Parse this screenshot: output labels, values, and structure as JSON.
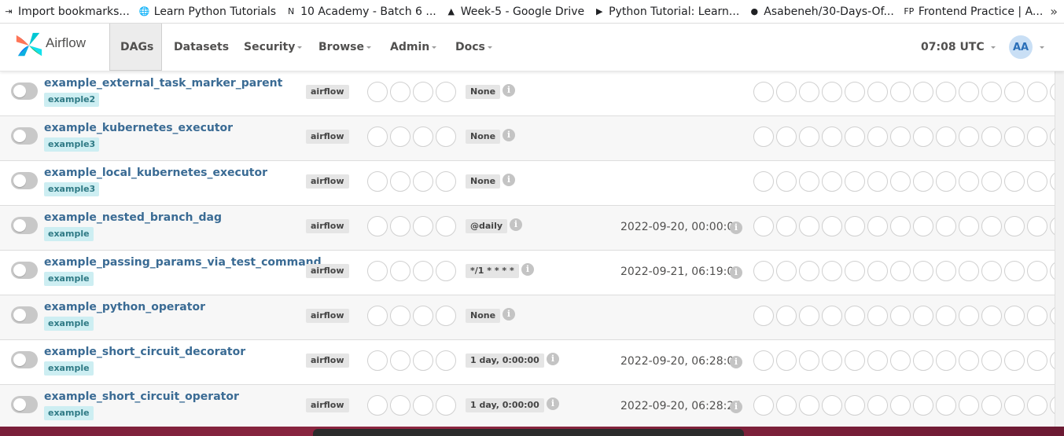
{
  "bookmarks": {
    "items": [
      {
        "label": "Import bookmarks...",
        "icon": "import-icon",
        "icon_glyph": "⇥"
      },
      {
        "label": "Learn Python Tutorials",
        "icon": "globe-icon",
        "icon_glyph": "🌐"
      },
      {
        "label": "10 Academy - Batch 6 ...",
        "icon": "notion-icon",
        "icon_glyph": "N"
      },
      {
        "label": "Week-5 - Google Drive",
        "icon": "google-drive-icon",
        "icon_glyph": "▲"
      },
      {
        "label": "Python Tutorial: Learn...",
        "icon": "youtube-icon",
        "icon_glyph": "▶"
      },
      {
        "label": "Asabeneh/30-Days-Of...",
        "icon": "github-icon",
        "icon_glyph": "●"
      },
      {
        "label": "Frontend Practice | A...",
        "icon": "fp-icon",
        "icon_glyph": "FP"
      }
    ],
    "more_glyph": "»"
  },
  "navbar": {
    "brand": "Airflow",
    "items": [
      {
        "label": "DAGs",
        "dropdown": false,
        "active": true
      },
      {
        "label": "Datasets",
        "dropdown": false,
        "active": false
      },
      {
        "label": "Security",
        "dropdown": true,
        "active": false
      },
      {
        "label": "Browse",
        "dropdown": true,
        "active": false
      },
      {
        "label": "Admin",
        "dropdown": true,
        "active": false
      },
      {
        "label": "Docs",
        "dropdown": true,
        "active": false
      }
    ],
    "clock": "07:08 UTC",
    "avatar": "AA"
  },
  "dags": [
    {
      "dag_id": "example_external_task_marker_parent",
      "tag": "example2",
      "owner": "airflow",
      "schedule": "None",
      "next_run": ""
    },
    {
      "dag_id": "example_kubernetes_executor",
      "tag": "example3",
      "owner": "airflow",
      "schedule": "None",
      "next_run": ""
    },
    {
      "dag_id": "example_local_kubernetes_executor",
      "tag": "example3",
      "owner": "airflow",
      "schedule": "None",
      "next_run": ""
    },
    {
      "dag_id": "example_nested_branch_dag",
      "tag": "example",
      "owner": "airflow",
      "schedule": "@daily",
      "next_run": "2022-09-20, 00:00:00"
    },
    {
      "dag_id": "example_passing_params_via_test_command",
      "tag": "example",
      "owner": "airflow",
      "schedule": "*/1 * * * *",
      "next_run": "2022-09-21, 06:19:00"
    },
    {
      "dag_id": "example_python_operator",
      "tag": "example",
      "owner": "airflow",
      "schedule": "None",
      "next_run": ""
    },
    {
      "dag_id": "example_short_circuit_decorator",
      "tag": "example",
      "owner": "airflow",
      "schedule": "1 day, 0:00:00",
      "next_run": "2022-09-20, 06:28:02"
    },
    {
      "dag_id": "example_short_circuit_operator",
      "tag": "example",
      "owner": "airflow",
      "schedule": "1 day, 0:00:00",
      "next_run": "2022-09-20, 06:28:25"
    }
  ],
  "info_glyph": "i",
  "colors": {
    "dag_link": "#3a6b94",
    "tag_bg": "#cdeef2",
    "airflow_blue": "#017cee",
    "airflow_green": "#00ad46",
    "airflow_red": "#e43921",
    "airflow_teal": "#04d659"
  }
}
